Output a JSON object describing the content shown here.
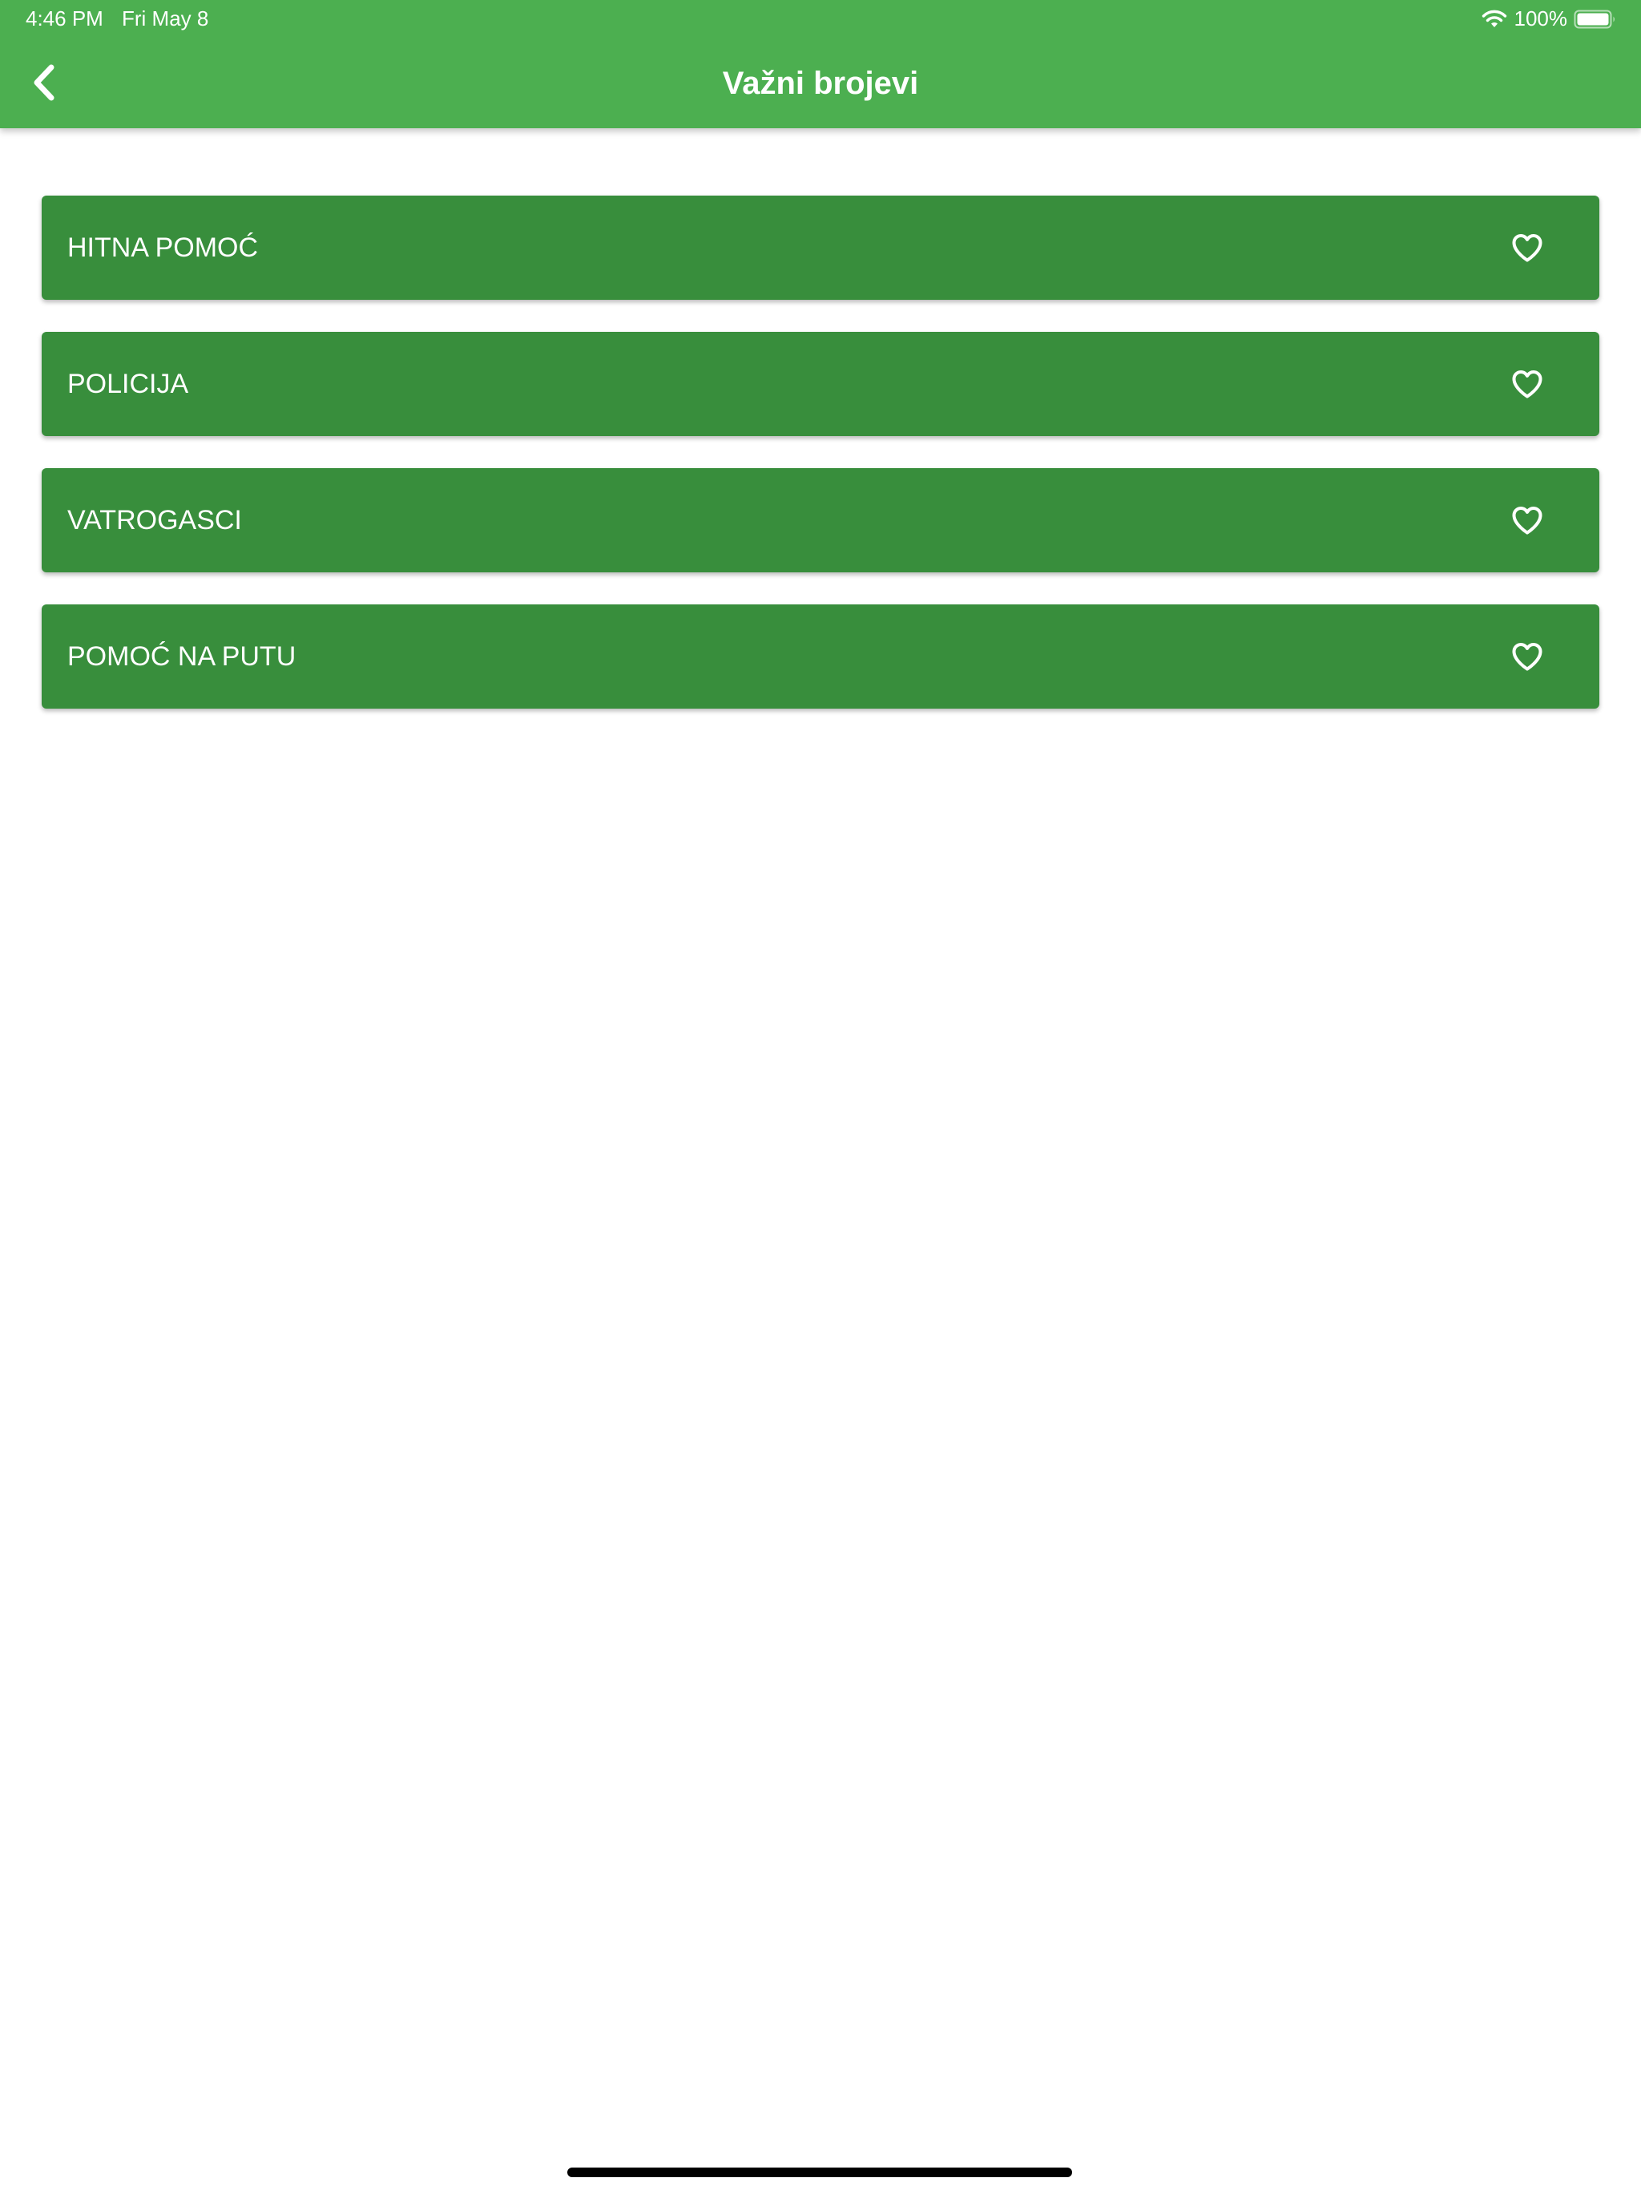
{
  "status_bar": {
    "time": "4:46 PM",
    "date": "Fri May 8",
    "battery_percent": "100%",
    "battery_level": 1.0,
    "wifi_icon": "wifi-icon",
    "battery_icon": "battery-icon"
  },
  "header": {
    "title": "Važni brojevi",
    "back_icon": "chevron-left-icon",
    "background_color": "#4caf50"
  },
  "list": {
    "item_color": "#388e3c",
    "favorite_icon": "heart-outline-icon",
    "items": [
      {
        "label": "HITNA POMOĆ"
      },
      {
        "label": "POLICIJA"
      },
      {
        "label": "VATROGASCI"
      },
      {
        "label": "POMOĆ NA PUTU"
      }
    ]
  }
}
